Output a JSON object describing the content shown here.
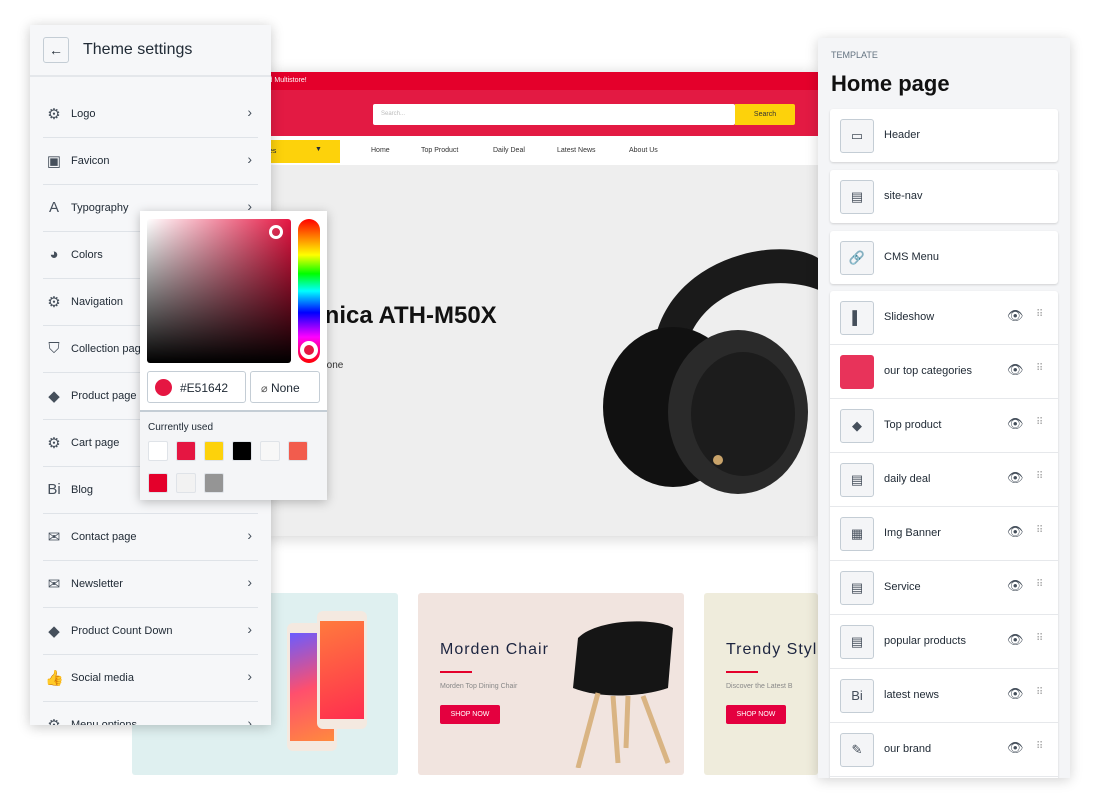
{
  "store": {
    "topbar_text": "ld Multistore!",
    "search_placeholder": "Search...",
    "search_button": "Search",
    "category_dropdown": "es",
    "nav": [
      "Home",
      "Top Product",
      "Daily Deal",
      "Latest News",
      "About Us"
    ],
    "hero_title": "hnica ATH-M50X",
    "hero_subtitle": "dphone",
    "accent": "#e31a43",
    "yellow": "#fdd20b"
  },
  "banners": [
    {
      "title": "",
      "subtitle": "",
      "button": ""
    },
    {
      "title": "Morden Chair",
      "subtitle": "Morden Top Dining Chair",
      "button": "SHOP NOW"
    },
    {
      "title": "Trendy Styl",
      "subtitle": "Discover the Latest B",
      "button": "SHOP NOW"
    }
  ],
  "theme_settings": {
    "title": "Theme settings",
    "items": [
      {
        "label": "Logo",
        "icon": "gear-icon"
      },
      {
        "label": "Favicon",
        "icon": "favicon-icon"
      },
      {
        "label": "Typography",
        "icon": "typography-icon"
      },
      {
        "label": "Colors",
        "icon": "palette-icon"
      },
      {
        "label": "Navigation",
        "icon": "gear-icon"
      },
      {
        "label": "Collection pag",
        "icon": "tags-icon"
      },
      {
        "label": "Product page",
        "icon": "tag-icon"
      },
      {
        "label": "Cart page",
        "icon": "gear-icon"
      },
      {
        "label": "Blog",
        "icon": "blog-icon"
      },
      {
        "label": "Contact page",
        "icon": "envelope-icon"
      },
      {
        "label": "Newsletter",
        "icon": "envelope-icon"
      },
      {
        "label": "Product Count Down",
        "icon": "tag-icon"
      },
      {
        "label": "Social media",
        "icon": "thumbs-up-icon"
      },
      {
        "label": "Menu options",
        "icon": "gear-icon"
      }
    ]
  },
  "color_picker": {
    "hex": "#E51642",
    "none_label": "None",
    "currently_used_label": "Currently used",
    "swatches": [
      "#ffffff",
      "#e51642",
      "#fdd20b",
      "#000000",
      "#f7f7f7",
      "#f25c4d",
      "#e4002b",
      "#f2f2f2",
      "#959595"
    ]
  },
  "template": {
    "label": "TEMPLATE",
    "title": "Home page",
    "fixed_sections": [
      {
        "label": "Header",
        "icon": "header-section-icon"
      },
      {
        "label": "site-nav",
        "icon": "nav-section-icon"
      },
      {
        "label": "CMS Menu",
        "icon": "link-icon"
      }
    ],
    "sections": [
      {
        "label": "Slideshow",
        "icon": "slideshow-thumb"
      },
      {
        "label": "our top categories",
        "icon": "category-thumb"
      },
      {
        "label": "Top product",
        "icon": "tag-icon"
      },
      {
        "label": "daily deal",
        "icon": "section-icon"
      },
      {
        "label": "Img Banner",
        "icon": "banner-thumb"
      },
      {
        "label": "Service",
        "icon": "section-icon"
      },
      {
        "label": "popular products",
        "icon": "section-icon"
      },
      {
        "label": "latest news",
        "icon": "blog-icon"
      },
      {
        "label": "our brand",
        "icon": "brand-thumb"
      }
    ]
  }
}
